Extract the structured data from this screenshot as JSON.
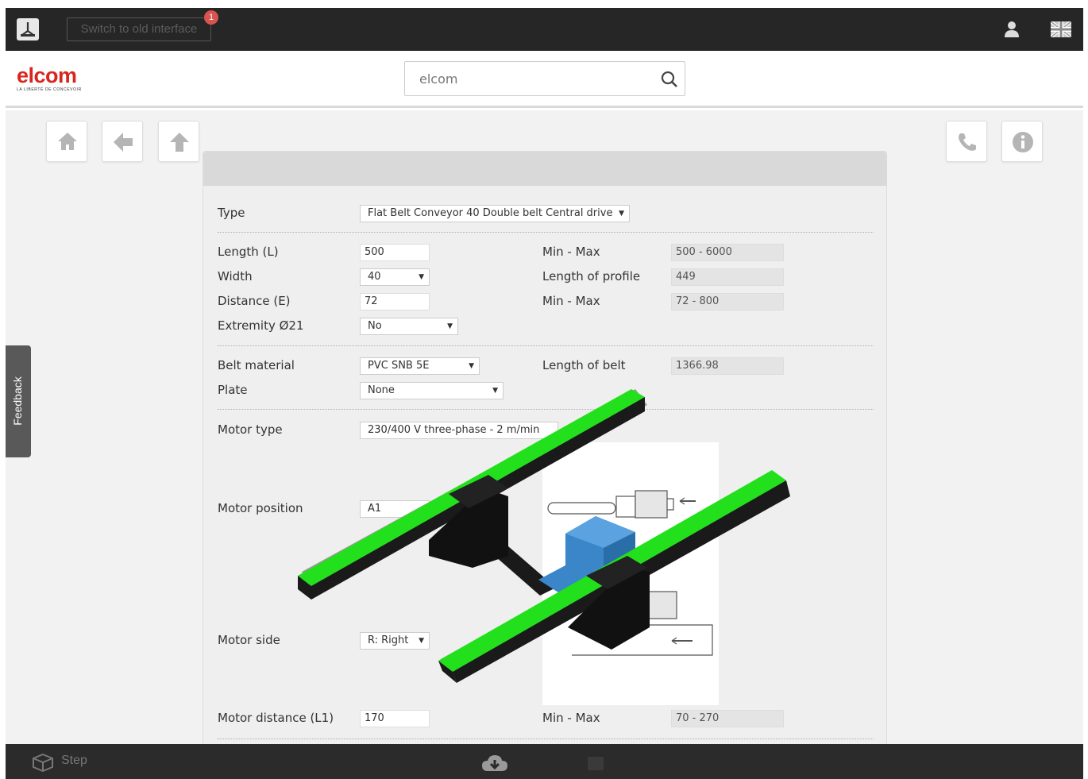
{
  "topbar": {
    "old_interface_label": "Switch to old interface",
    "notification_count": "1"
  },
  "header": {
    "brand": "elcom",
    "brand_tagline": "LA LIBERTÉ DE CONCEVOIR",
    "search_value": "elcom"
  },
  "form": {
    "type_label": "Type",
    "type_value": "Flat Belt Conveyor 40 Double belt Central drive",
    "length_label": "Length (L)",
    "length_value": "500",
    "length_minmax_label": "Min - Max",
    "length_minmax_value": "500 - 6000",
    "width_label": "Width",
    "width_value": "40",
    "profile_length_label": "Length of profile",
    "profile_length_value": "449",
    "distance_label": "Distance (E)",
    "distance_value": "72",
    "distance_minmax_label": "Min - Max",
    "distance_minmax_value": "72 - 800",
    "extremity_label": "Extremity Ø21",
    "extremity_value": "No",
    "belt_material_label": "Belt material",
    "belt_material_value": "PVC SNB 5E",
    "belt_length_label": "Length of belt",
    "belt_length_value": "1366.98",
    "plate_label": "Plate",
    "plate_value": "None",
    "motor_type_label": "Motor type",
    "motor_type_value": "230/400 V three-phase - 2 m/min",
    "motor_position_label": "Motor position",
    "motor_position_value": "A1",
    "motor_side_label": "Motor side",
    "motor_side_value": "R: Right",
    "motor_distance_label": "Motor distance (L1)",
    "motor_distance_value": "170",
    "motor_distance_minmax_label": "Min - Max",
    "motor_distance_minmax_value": "70 - 270"
  },
  "feedback_label": "Feedback",
  "bottombar": {
    "step_label": "Step"
  },
  "colors": {
    "brand_red": "#d9261c",
    "belt_green": "#22e01b",
    "motor_blue": "#3a86c9",
    "dark_bar": "#262626"
  }
}
